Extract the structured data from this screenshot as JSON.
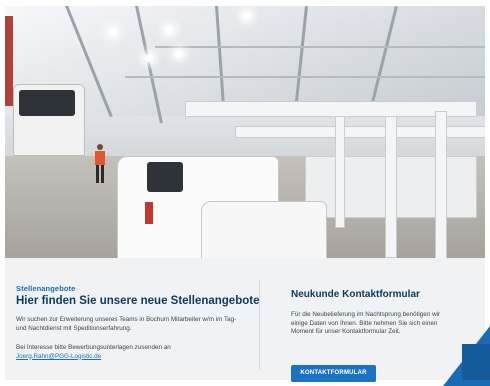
{
  "hero": {
    "alt": "Lagerhalle mit Transportern"
  },
  "jobs": {
    "eyebrow": "Stellenangebote",
    "title": "Hier finden Sie unsere neue Stellenangebote",
    "text": "Wir suchen zur Erweiterung unseres Teams in Bochum Mitarbeiter w/m im Tag- und Nachtdienst mit Speditionserfahrung.",
    "apply_text": "Bei Interesse bitte Bewerbungsunterlagen zusenden an",
    "email": "Joerg.Rahn@PGG-Logistic.de"
  },
  "contact": {
    "title": "Neukunde Kontaktformular",
    "text": "Für die Neubelieferung im Nachtsprung benötigen wir einige Daten von Ihnen. Bitte nehmen Sie sich einen Moment für unser Kontaktformular Zeit.",
    "button_label": "KONTAKTFORMULAR"
  },
  "colors": {
    "brand_blue": "#1c73c4",
    "title_navy": "#0e3a5c",
    "panel_bg": "#f1f2f4"
  }
}
